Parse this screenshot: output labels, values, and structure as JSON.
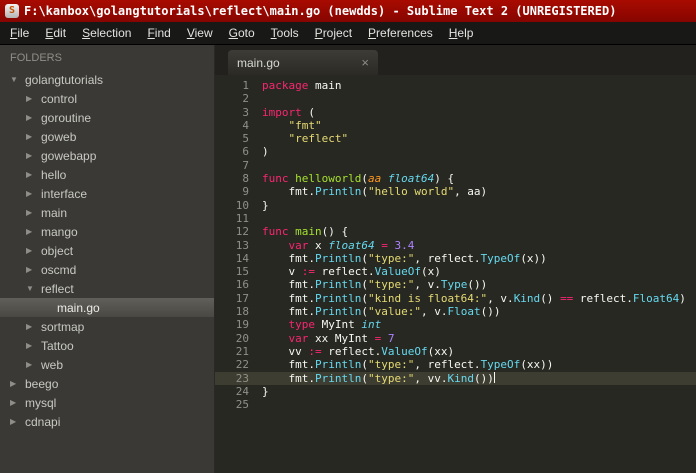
{
  "window": {
    "title": "F:\\kanbox\\golangtutorials\\reflect\\main.go (newdds) - Sublime Text 2 (UNREGISTERED)",
    "app_icon": "S"
  },
  "menu": {
    "items": [
      {
        "label": "File",
        "underline": 0
      },
      {
        "label": "Edit",
        "underline": 0
      },
      {
        "label": "Selection",
        "underline": 0
      },
      {
        "label": "Find",
        "underline": 0
      },
      {
        "label": "View",
        "underline": 0
      },
      {
        "label": "Goto",
        "underline": 0
      },
      {
        "label": "Tools",
        "underline": 0
      },
      {
        "label": "Project",
        "underline": 0
      },
      {
        "label": "Preferences",
        "underline": 0
      },
      {
        "label": "Help",
        "underline": 0
      }
    ]
  },
  "sidebar": {
    "header": "FOLDERS",
    "items": [
      {
        "label": "golangtutorials",
        "level": 0,
        "type": "folder",
        "expanded": true,
        "selected": false
      },
      {
        "label": "control",
        "level": 1,
        "type": "folder",
        "expanded": false,
        "selected": false
      },
      {
        "label": "goroutine",
        "level": 1,
        "type": "folder",
        "expanded": false,
        "selected": false
      },
      {
        "label": "goweb",
        "level": 1,
        "type": "folder",
        "expanded": false,
        "selected": false
      },
      {
        "label": "gowebapp",
        "level": 1,
        "type": "folder",
        "expanded": false,
        "selected": false
      },
      {
        "label": "hello",
        "level": 1,
        "type": "folder",
        "expanded": false,
        "selected": false
      },
      {
        "label": "interface",
        "level": 1,
        "type": "folder",
        "expanded": false,
        "selected": false
      },
      {
        "label": "main",
        "level": 1,
        "type": "folder",
        "expanded": false,
        "selected": false
      },
      {
        "label": "mango",
        "level": 1,
        "type": "folder",
        "expanded": false,
        "selected": false
      },
      {
        "label": "object",
        "level": 1,
        "type": "folder",
        "expanded": false,
        "selected": false
      },
      {
        "label": "oscmd",
        "level": 1,
        "type": "folder",
        "expanded": false,
        "selected": false
      },
      {
        "label": "reflect",
        "level": 1,
        "type": "folder",
        "expanded": true,
        "selected": false
      },
      {
        "label": "main.go",
        "level": 2,
        "type": "file",
        "expanded": false,
        "selected": true
      },
      {
        "label": "sortmap",
        "level": 1,
        "type": "folder",
        "expanded": false,
        "selected": false
      },
      {
        "label": "Tattoo",
        "level": 1,
        "type": "folder",
        "expanded": false,
        "selected": false
      },
      {
        "label": "web",
        "level": 1,
        "type": "folder",
        "expanded": false,
        "selected": false
      },
      {
        "label": "beego",
        "level": 0,
        "type": "folder",
        "expanded": false,
        "selected": false
      },
      {
        "label": "mysql",
        "level": 0,
        "type": "folder",
        "expanded": false,
        "selected": false
      },
      {
        "label": "cdnapi",
        "level": 0,
        "type": "folder",
        "expanded": false,
        "selected": false
      }
    ]
  },
  "tabbar": {
    "tabs": [
      {
        "label": "main.go",
        "close": "×",
        "active": true
      }
    ]
  },
  "editor": {
    "cursor_line": 23,
    "total_lines": 25,
    "lines": [
      [
        [
          "k",
          "package"
        ],
        [
          "p",
          " main"
        ]
      ],
      [],
      [
        [
          "k",
          "import"
        ],
        [
          "p",
          " ("
        ]
      ],
      [
        [
          "p",
          "    "
        ],
        [
          "s",
          "\"fmt\""
        ]
      ],
      [
        [
          "p",
          "    "
        ],
        [
          "s",
          "\"reflect\""
        ]
      ],
      [
        [
          "p",
          ")"
        ]
      ],
      [],
      [
        [
          "k",
          "func "
        ],
        [
          "f",
          "helloworld"
        ],
        [
          "p",
          "("
        ],
        [
          "a",
          "aa"
        ],
        [
          "p",
          " "
        ],
        [
          "t",
          "float64"
        ],
        [
          "p",
          ") {"
        ]
      ],
      [
        [
          "p",
          "    fmt."
        ],
        [
          "c",
          "Println"
        ],
        [
          "p",
          "("
        ],
        [
          "s",
          "\"hello world\""
        ],
        [
          "p",
          ", aa)"
        ]
      ],
      [
        [
          "p",
          "}"
        ]
      ],
      [],
      [
        [
          "k",
          "func "
        ],
        [
          "f",
          "main"
        ],
        [
          "p",
          "() {"
        ]
      ],
      [
        [
          "p",
          "    "
        ],
        [
          "k",
          "var"
        ],
        [
          "p",
          " x "
        ],
        [
          "t",
          "float64"
        ],
        [
          "p",
          " "
        ],
        [
          "k",
          "="
        ],
        [
          "p",
          " "
        ],
        [
          "n",
          "3.4"
        ]
      ],
      [
        [
          "p",
          "    fmt."
        ],
        [
          "c",
          "Println"
        ],
        [
          "p",
          "("
        ],
        [
          "s",
          "\"type:\""
        ],
        [
          "p",
          ", reflect."
        ],
        [
          "c",
          "TypeOf"
        ],
        [
          "p",
          "(x))"
        ]
      ],
      [
        [
          "p",
          "    v "
        ],
        [
          "k",
          ":="
        ],
        [
          "p",
          " reflect."
        ],
        [
          "c",
          "ValueOf"
        ],
        [
          "p",
          "(x)"
        ]
      ],
      [
        [
          "p",
          "    fmt."
        ],
        [
          "c",
          "Println"
        ],
        [
          "p",
          "("
        ],
        [
          "s",
          "\"type:\""
        ],
        [
          "p",
          ", v."
        ],
        [
          "c",
          "Type"
        ],
        [
          "p",
          "())"
        ]
      ],
      [
        [
          "p",
          "    fmt."
        ],
        [
          "c",
          "Println"
        ],
        [
          "p",
          "("
        ],
        [
          "s",
          "\"kind is float64:\""
        ],
        [
          "p",
          ", v."
        ],
        [
          "c",
          "Kind"
        ],
        [
          "p",
          "() "
        ],
        [
          "k",
          "=="
        ],
        [
          "p",
          " reflect."
        ],
        [
          "c",
          "Float64"
        ],
        [
          "p",
          ")"
        ]
      ],
      [
        [
          "p",
          "    fmt."
        ],
        [
          "c",
          "Println"
        ],
        [
          "p",
          "("
        ],
        [
          "s",
          "\"value:\""
        ],
        [
          "p",
          ", v."
        ],
        [
          "c",
          "Float"
        ],
        [
          "p",
          "())"
        ]
      ],
      [
        [
          "p",
          "    "
        ],
        [
          "k",
          "type"
        ],
        [
          "p",
          " MyInt "
        ],
        [
          "t",
          "int"
        ]
      ],
      [
        [
          "p",
          "    "
        ],
        [
          "k",
          "var"
        ],
        [
          "p",
          " xx MyInt "
        ],
        [
          "k",
          "="
        ],
        [
          "p",
          " "
        ],
        [
          "n",
          "7"
        ]
      ],
      [
        [
          "p",
          "    vv "
        ],
        [
          "k",
          ":="
        ],
        [
          "p",
          " reflect."
        ],
        [
          "c",
          "ValueOf"
        ],
        [
          "p",
          "(xx)"
        ]
      ],
      [
        [
          "p",
          "    fmt."
        ],
        [
          "c",
          "Println"
        ],
        [
          "p",
          "("
        ],
        [
          "s",
          "\"type:\""
        ],
        [
          "p",
          ", reflect."
        ],
        [
          "c",
          "TypeOf"
        ],
        [
          "p",
          "(xx))"
        ]
      ],
      [
        [
          "p",
          "    fmt."
        ],
        [
          "c",
          "Println"
        ],
        [
          "p",
          "("
        ],
        [
          "s",
          "\"type:\""
        ],
        [
          "p",
          ", vv."
        ],
        [
          "c",
          "Kind"
        ],
        [
          "p",
          "())"
        ]
      ],
      [
        [
          "p",
          "}"
        ]
      ],
      []
    ]
  },
  "colors": {
    "titlebar_red": "#9b0900",
    "editor_bg": "#272822",
    "sidebar_bg": "#3a3935",
    "active_line": "#3e3d32",
    "keyword": "#f92672",
    "string": "#e6db74",
    "function_def": "#a6e22e",
    "type": "#66d9ef",
    "number": "#ae81ff",
    "call": "#66d9ef",
    "text": "#f8f8f2",
    "line_number": "#8f908a"
  }
}
